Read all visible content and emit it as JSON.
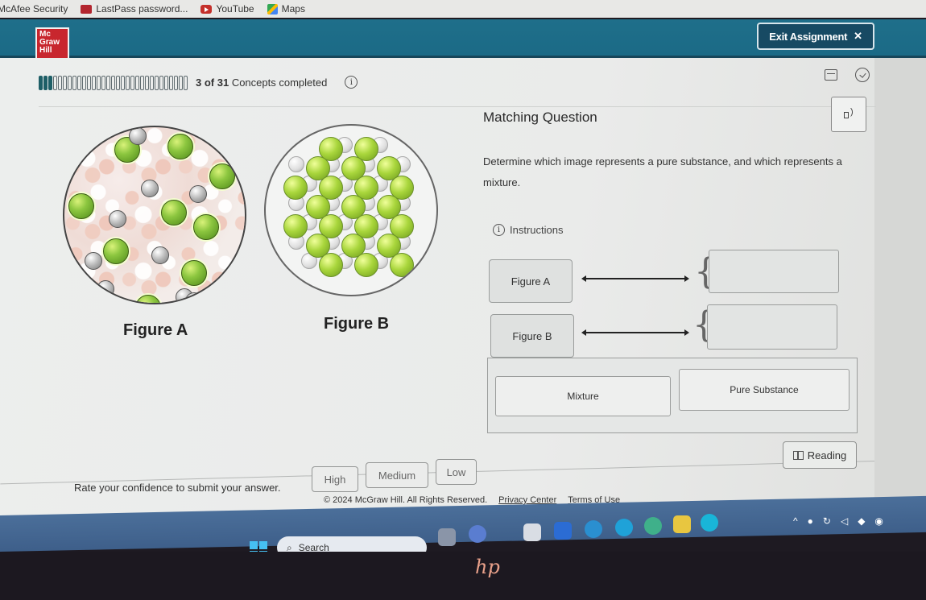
{
  "browser": {
    "bookmarks": [
      {
        "label": "McAfee Security",
        "icon": "none"
      },
      {
        "label": "LastPass password...",
        "icon": "lastpass-icon"
      },
      {
        "label": "YouTube",
        "icon": "youtube-icon"
      },
      {
        "label": "Maps",
        "icon": "maps-icon"
      }
    ]
  },
  "header": {
    "logo_lines": [
      "Mc",
      "Graw",
      "Hill"
    ],
    "exit_label": "Exit Assignment",
    "exit_icon": "✕"
  },
  "progress": {
    "completed": 3,
    "total": 31,
    "count_text": "3 of 31",
    "label": "Concepts completed",
    "info_icon": "i"
  },
  "figures": {
    "a_label": "Figure A",
    "b_label": "Figure B"
  },
  "question": {
    "title": "Matching Question",
    "prompt": "Determine which image represents a pure substance, and which represents a mixture.",
    "instructions_label": "Instructions",
    "items": [
      {
        "label": "Figure A",
        "answer": ""
      },
      {
        "label": "Figure B",
        "answer": ""
      }
    ],
    "choices": [
      "Mixture",
      "Pure Substance"
    ],
    "reading_label": "Reading"
  },
  "confidence": {
    "prompt": "Rate your confidence to submit your answer.",
    "options": [
      "High",
      "Medium",
      "Low"
    ]
  },
  "footer": {
    "copyright": "© 2024 McGraw Hill. All Rights Reserved.",
    "links": [
      "Privacy Center",
      "Terms of Use"
    ]
  },
  "taskbar": {
    "search_placeholder": "Search"
  },
  "colors": {
    "header": "#1f6f8a",
    "logo": "#c8262e",
    "progress_fill": "#1e5f67"
  }
}
